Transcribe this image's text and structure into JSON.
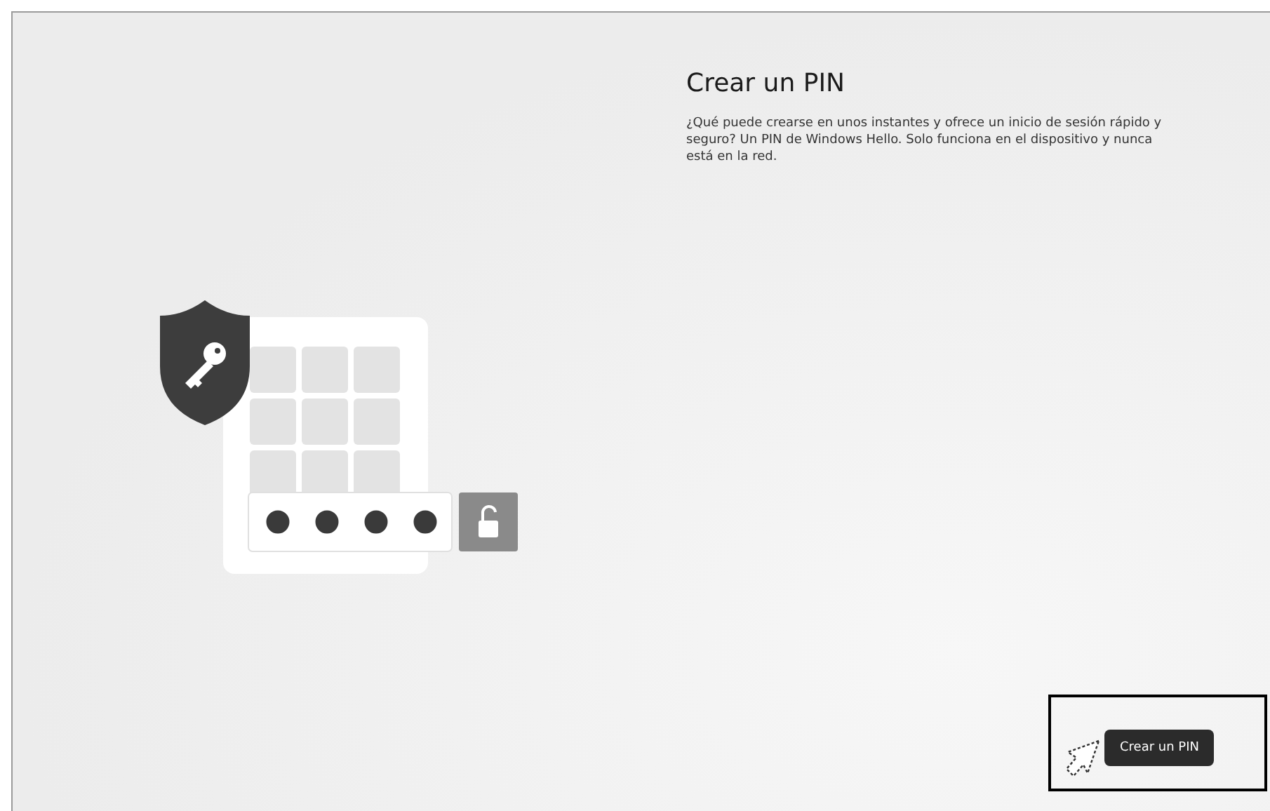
{
  "page": {
    "title": "Crear un PIN",
    "description": "¿Qué puede crearse en unos instantes y ofrece un inicio de sesión rápido y seguro? Un PIN de Windows Hello. Solo funciona en el dispositivo y nunca está en la red."
  },
  "pin_preview": {
    "dots": [
      {
        "filled": true
      },
      {
        "filled": true
      },
      {
        "filled": true
      },
      {
        "filled": true
      }
    ]
  },
  "primary_button": {
    "label": "Crear un PIN",
    "highlighted": true
  }
}
